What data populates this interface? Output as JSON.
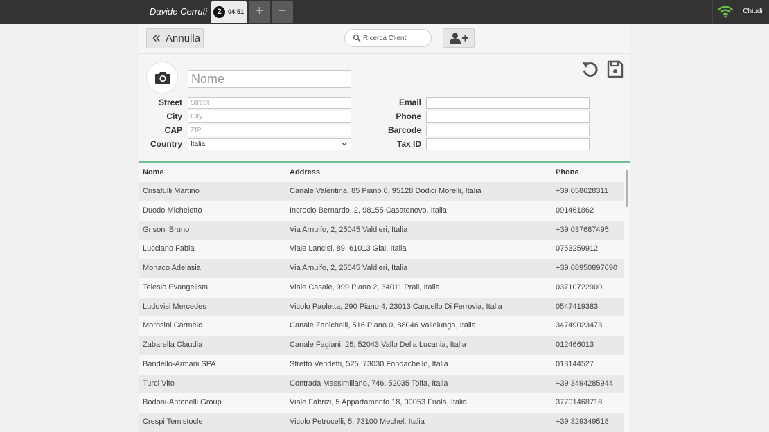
{
  "topbar": {
    "user_name": "Davide Cerruti",
    "tab_number": "2",
    "tab_time": "04:51",
    "add_tab_glyph": "+",
    "remove_tab_glyph": "−",
    "close_label": "Chiudi",
    "wifi_color": "#6cc04a"
  },
  "header": {
    "cancel_label": "Annulla",
    "cancel_icon": "double-chevron-left-icon",
    "search_placeholder": "Ricerca Clienti",
    "add_customer_icon": "add-user-icon"
  },
  "form": {
    "name_placeholder": "Nome",
    "left_fields": [
      {
        "label": "Street",
        "placeholder": "Street"
      },
      {
        "label": "City",
        "placeholder": "City"
      },
      {
        "label": "CAP",
        "placeholder": "ZIP"
      },
      {
        "label": "Country",
        "value": "Italia"
      }
    ],
    "right_fields": [
      {
        "label": "Email",
        "value": ""
      },
      {
        "label": "Phone",
        "value": ""
      },
      {
        "label": "Barcode",
        "value": ""
      },
      {
        "label": "Tax ID",
        "value": ""
      }
    ],
    "accent_color": "#6dbf94"
  },
  "table": {
    "columns": [
      "Nome",
      "Address",
      "Phone"
    ],
    "rows": [
      [
        "Crisafulli Martino",
        "Canale Valentina, 85 Piano 6, 95128 Dodici Morelli, Italia",
        "+39 058628311"
      ],
      [
        "Duodo Micheletto",
        "Incrocio Bernardo, 2, 98155 Casatenovo, Italia",
        "091461862"
      ],
      [
        "Grisoni Bruno",
        "Via Arnulfo, 2, 25045 Valdieri, Italia",
        "+39 037687495"
      ],
      [
        "Lucciano Fabia",
        "Viale Lancisi, 89, 61013 Giai, Italia",
        "0753259912"
      ],
      [
        "Monaco Adelasia",
        "Via Arnulfo, 2, 25045 Valdieri, Italia",
        "+39 08950897690"
      ],
      [
        "Telesio Evangelista",
        "Viale Casale, 999 Piano 2, 34011 Prali, Italia",
        "03710722900"
      ],
      [
        "Ludovisi Mercedes",
        "Vicolo Paoletta, 290 Piano 4, 23013 Cancello Di Ferrovia, Italia",
        "0547419383"
      ],
      [
        "Morosini Carmelo",
        "Canale Zanichelli, 516 Piano 0, 88046 Vallelunga, Italia",
        "34749023473"
      ],
      [
        "Zabarella Claudia",
        "Canale Fagiani, 25, 52043 Vallo Della Lucania, Italia",
        "012466013"
      ],
      [
        "Bandello-Armani SPA",
        "Stretto Vendetti, 525, 73030 Fondachello, Italia",
        "013144527"
      ],
      [
        "Turci Vito",
        "Contrada Massimiliano, 746, 52035 Tolfa, Italia",
        "+39 3494285944"
      ],
      [
        "Bodoni-Antonelli Group",
        "Viale Fabrizi, 5 Appartamento 18, 00053 Friola, Italia",
        "37701468718"
      ],
      [
        "Crespi Temistocle",
        "Vicolo Petrucelli, 5, 73100 Mechel, Italia",
        "+39 329349518"
      ]
    ]
  }
}
